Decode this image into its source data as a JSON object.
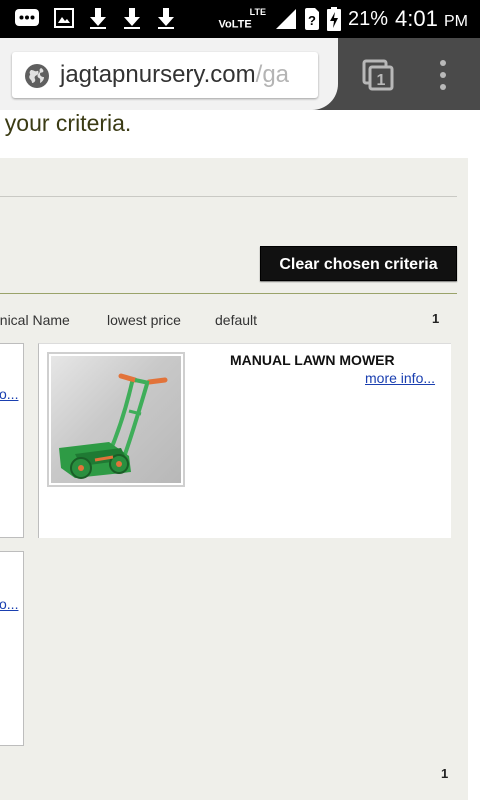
{
  "status_bar": {
    "network": "VoLTE",
    "network_sup": "LTE",
    "battery": "21%",
    "time": "4:01",
    "ampm": "PM"
  },
  "browser": {
    "url_host": "jagtapnursery.com",
    "url_path": "/ga",
    "tab_count": "1"
  },
  "page": {
    "criteria_text": "t your criteria.",
    "clear_button": "Clear chosen criteria",
    "sort": {
      "botanical": "anical Name",
      "lowest_price": "lowest price",
      "default": "default"
    },
    "page_top": "1",
    "page_bottom": "1",
    "partial_link": "o...",
    "product": {
      "name": "MANUAL LAWN MOWER",
      "more_info": "more info..."
    }
  },
  "colors": {
    "status_bar": "#000000",
    "toolbar": "#4a4a4a",
    "panel": "#efefea",
    "link": "#1a3fb0",
    "button": "#111111"
  }
}
